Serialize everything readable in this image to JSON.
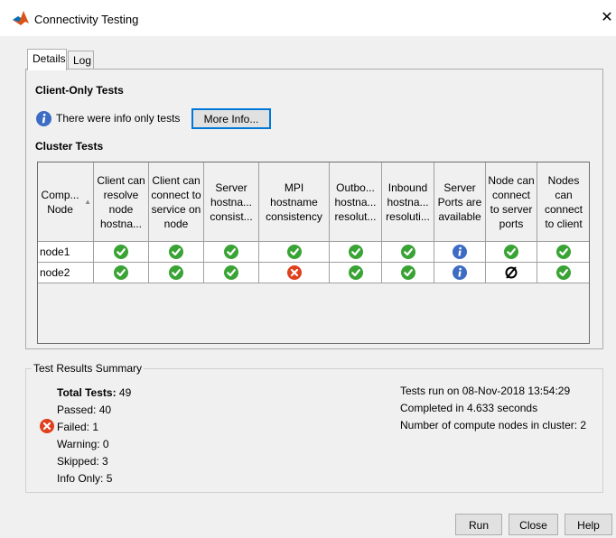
{
  "window": {
    "title": "Connectivity Testing",
    "close_glyph": "✕"
  },
  "tabs": [
    {
      "label": "Details",
      "active": true
    },
    {
      "label": "Log",
      "active": false
    }
  ],
  "client_only": {
    "heading": "Client-Only Tests",
    "info_text": "There were info only tests",
    "more_info_label": "More Info..."
  },
  "cluster": {
    "heading": "Cluster Tests",
    "columns": [
      "Comp... Node",
      "Client can resolve node hostna...",
      "Client can connect to service on node",
      "Server hostna... consist...",
      "MPI hostname consistency",
      "Outbo... hostna... resolut...",
      "Inbound hostna... resoluti...",
      "Server Ports are available",
      "Node can connect to server ports",
      "Nodes can connect to client"
    ],
    "rows": [
      {
        "node": "node1",
        "results": [
          "pass",
          "pass",
          "pass",
          "pass",
          "pass",
          "pass",
          "info",
          "pass",
          "pass"
        ]
      },
      {
        "node": "node2",
        "results": [
          "pass",
          "pass",
          "pass",
          "fail",
          "pass",
          "pass",
          "info",
          "skip",
          "pass"
        ]
      }
    ]
  },
  "summary": {
    "title": "Test Results Summary",
    "total_label": "Total Tests:",
    "total_value": "49",
    "passed": "Passed: 40",
    "failed": "Failed: 1",
    "warning": "Warning: 0",
    "skipped": "Skipped: 3",
    "info_only": "Info Only: 5",
    "run_on": "Tests run on 08-Nov-2018 13:54:29",
    "completed": "Completed in 4.633 seconds",
    "nodes": "Number of compute nodes in cluster: 2"
  },
  "buttons": {
    "run": "Run",
    "close": "Close",
    "help": "Help"
  },
  "colors": {
    "pass": "#3aa335",
    "fail": "#e0401e",
    "info": "#3c6cc4",
    "accent": "#0078d7"
  },
  "icons": {
    "pass": "check-circle-icon",
    "fail": "x-circle-icon",
    "info": "info-circle-icon",
    "skip": "null-set-icon",
    "app": "matlab-logo-icon"
  }
}
